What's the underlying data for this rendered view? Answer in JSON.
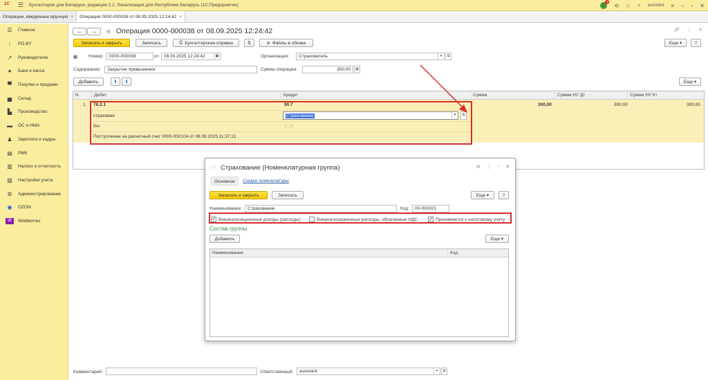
{
  "app": {
    "logo": "1С",
    "title": "Бухгалтерия для Беларуси, редакция 2.1. Локализация для Республики Беларусь   (1С:Предприятие)",
    "user": "assistant",
    "notif_count": "1"
  },
  "tabs": [
    {
      "label": "Операции, введенные вручную"
    },
    {
      "label": "Операция 0000-000038 от 08.09.2025 12:24:42"
    }
  ],
  "sidebar": {
    "items": [
      {
        "label": "Главное",
        "icon": "menu-icon"
      },
      {
        "label": "PO.BY",
        "icon": "lines-icon"
      },
      {
        "label": "Руководителю",
        "icon": "trend-icon"
      },
      {
        "label": "Банк и касса",
        "icon": "bank-icon"
      },
      {
        "label": "Покупки и продажи",
        "icon": "cart-icon"
      },
      {
        "label": "Склад",
        "icon": "warehouse-icon"
      },
      {
        "label": "Производство",
        "icon": "factory-icon"
      },
      {
        "label": "ОС и НМА",
        "icon": "truck-icon"
      },
      {
        "label": "Зарплата и кадры",
        "icon": "people-icon"
      },
      {
        "label": "РМК",
        "icon": "register-icon"
      },
      {
        "label": "Налоги и отчетность",
        "icon": "report-icon"
      },
      {
        "label": "Настройки учета",
        "icon": "settings-doc-icon"
      },
      {
        "label": "Администрирование",
        "icon": "gear-icon"
      },
      {
        "label": "OZON",
        "icon": "ozon-icon"
      },
      {
        "label": "Wildberries",
        "icon": "wildberries-icon"
      }
    ]
  },
  "doc": {
    "title": "Операция 0000-000038 от 08.09.2025 12:24:42",
    "btn_save_close": "Записать и закрыть",
    "btn_save": "Записать",
    "btn_acc_ref": "Бухгалтерская справка",
    "btn_files": "Файлы в облаке",
    "btn_more": "Еще",
    "lbl_number": "Номер:",
    "number": "0000-000038",
    "lbl_from": "от:",
    "date": "08.09.2025 12:24:42",
    "lbl_org": "Организация:",
    "org": "Страхователь",
    "lbl_content": "Содержание:",
    "content": "Закрытие превышения",
    "lbl_sum": "Сумма операции:",
    "sum": "300,00",
    "btn_add": "Добавить",
    "btn_more2": "Еще"
  },
  "table": {
    "headers": [
      "N",
      "Дебет",
      "Кредит",
      "Сумма",
      "Сумма НУ Дт",
      "Сумма НУ Кт"
    ],
    "row": {
      "n": "1",
      "debit": "76.2.1",
      "debit_sub1": "страховая",
      "debit_sub2": "б/н",
      "debit_sub3": "Поступление на расчетный счет 0000-000104 от 08.09.2025 11:37:21",
      "credit": "90.7",
      "credit_sub1": "Страхование",
      "credit_sub2": "<...>",
      "sum": "300,00",
      "sum_nu_dt": "300,00",
      "sum_nu_kt": "300,00"
    }
  },
  "dialog": {
    "title": "Страхование (Номенклатурная группа)",
    "tab_main": "Основное",
    "tab_discounts": "Скидки номенклатуры",
    "btn_save_close": "Записать и закрыть",
    "btn_save": "Записать",
    "btn_more": "Еще",
    "btn_help": "?",
    "lbl_name": "Наименование:",
    "name": "Страхование",
    "lbl_code": "Код:",
    "code": "00-000021",
    "cb1": "Внереализационные доходы (расходы)",
    "cb2": "Внереализационные расходы, облагаемые НДС",
    "cb3": "Принимается к налоговому учету",
    "section": "Состав группы",
    "btn_add": "Добавить",
    "btn_more2": "Еще",
    "col_name": "Наименование",
    "col_code": "Код"
  },
  "footer": {
    "lbl_comment": "Комментарий:",
    "comment": "",
    "lbl_resp": "Ответственный:",
    "resp": "assistant"
  },
  "colors": {
    "accent": "#fbed9e",
    "highlight": "#d82c2c",
    "button_yellow": "#f6c800"
  }
}
